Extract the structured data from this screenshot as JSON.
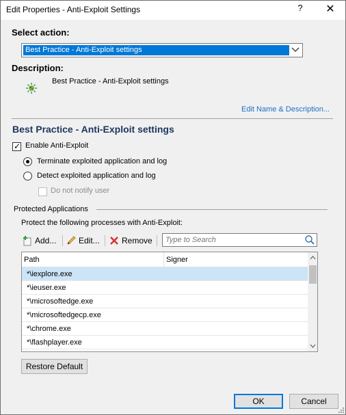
{
  "window": {
    "title": "Edit Properties - Anti-Exploit Settings",
    "help_glyph": "?",
    "close_glyph": "✕"
  },
  "select_action": {
    "label": "Select action:",
    "selected": "Best Practice - Anti-Exploit settings"
  },
  "description": {
    "label": "Description:",
    "text": "Best Practice - Anti-Exploit settings",
    "icon": "shield-virus-icon",
    "edit_link": "Edit Name & Description..."
  },
  "section": {
    "title": "Best Practice - Anti-Exploit settings",
    "enable_label": "Enable Anti-Exploit",
    "enable_checked": true,
    "radio_terminate": "Terminate exploited application and log",
    "radio_detect": "Detect exploited application and log",
    "terminate_selected": true,
    "do_not_notify": "Do not notify user",
    "do_not_notify_checked": false
  },
  "protected": {
    "group_label": "Protected Applications",
    "intro": "Protect the following processes with Anti-Exploit:",
    "toolbar": {
      "add": "Add...",
      "edit": "Edit...",
      "remove": "Remove"
    },
    "search_placeholder": "Type to Search",
    "columns": [
      "Path",
      "Signer"
    ],
    "rows": [
      "*\\iexplore.exe",
      "*\\ieuser.exe",
      "*\\microsoftedge.exe",
      "*\\microsoftedgecp.exe",
      "*\\chrome.exe",
      "*\\flashplayer.exe"
    ],
    "selected_row": 0,
    "restore_default": "Restore Default"
  },
  "footer": {
    "ok": "OK",
    "cancel": "Cancel"
  },
  "colors": {
    "accent": "#0078d7",
    "selection": "#cce4f7",
    "section_title": "#1b365d",
    "link": "#1f6fc5"
  }
}
